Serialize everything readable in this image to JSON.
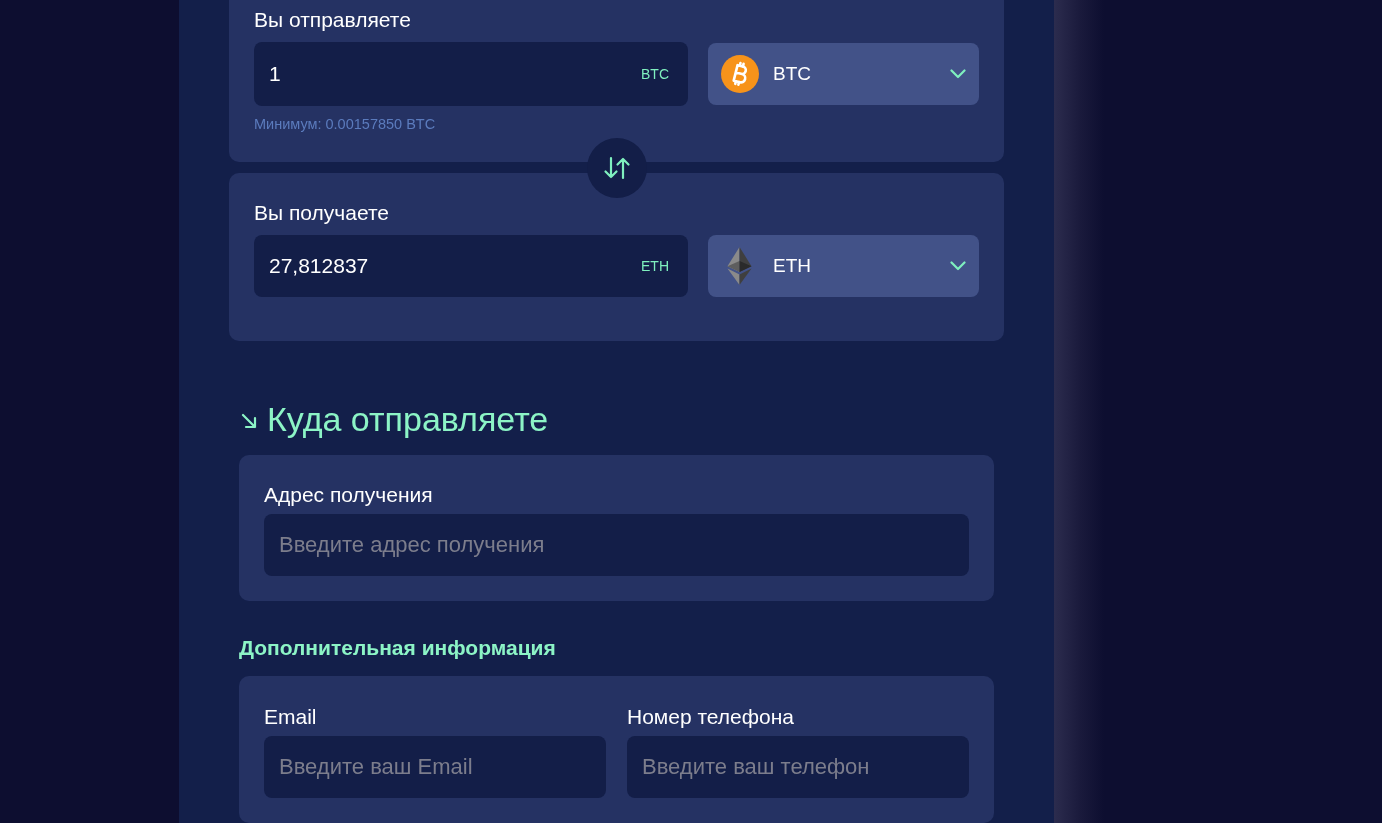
{
  "exchange": [
    {
      "label": "Вы отправляете",
      "amount": "1",
      "unit": "BTC",
      "currency": {
        "code": "BTC",
        "kind": "bitcoin"
      },
      "minimum": "Минимум: 0.00157850 BTC"
    },
    {
      "label": "Вы получаете",
      "amount": "27,812837",
      "unit": "ETH",
      "currency": {
        "code": "ETH",
        "kind": "ether"
      }
    }
  ],
  "destination": {
    "title": "Куда отправляете",
    "field": {
      "label": "Адрес получения",
      "placeholder": "Введите адрес получения"
    }
  },
  "additional": {
    "title": "Дополнительная информация",
    "fields": [
      {
        "label": "Email",
        "placeholder": "Введите ваш Email"
      },
      {
        "label": "Номер телефона",
        "placeholder": "Введите ваш телефон"
      }
    ]
  }
}
